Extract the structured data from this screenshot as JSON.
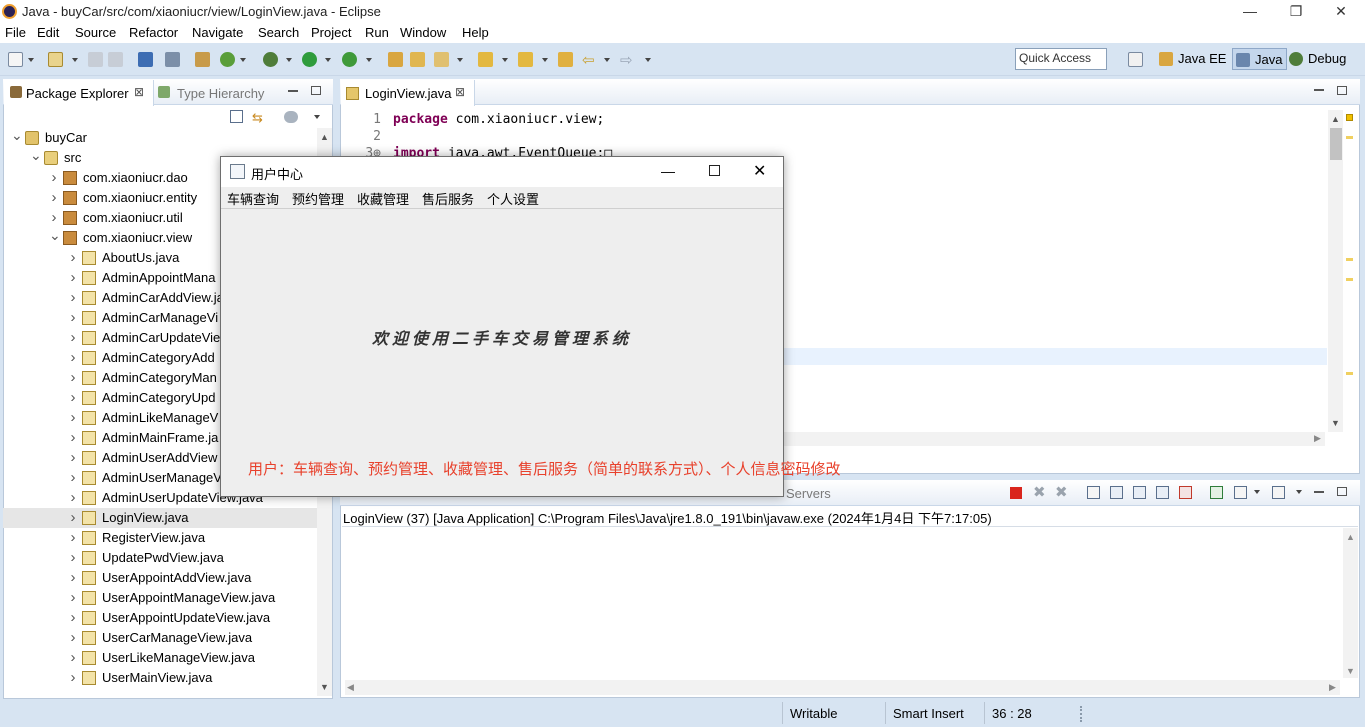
{
  "window": {
    "title": "Java - buyCar/src/com/xiaoniucr/view/LoginView.java - Eclipse",
    "minimize": "—",
    "maximize": "❐",
    "close": "✕"
  },
  "menubar": {
    "items": [
      "File",
      "Edit",
      "Source",
      "Refactor",
      "Navigate",
      "Search",
      "Project",
      "Run",
      "Window",
      "Help"
    ]
  },
  "toolbar": {
    "quick_access_placeholder": "Quick Access",
    "perspectives": [
      "Java EE",
      "Java",
      "Debug"
    ]
  },
  "left_panel": {
    "tabs": [
      "Package Explorer",
      "Type Hierarchy"
    ],
    "tree": [
      {
        "label": "buyCar",
        "icon": "project-icon",
        "expanded": true
      },
      {
        "label": "src",
        "icon": "source-folder-icon",
        "expanded": true
      },
      {
        "label": "com.xiaoniucr.dao",
        "icon": "package-icon",
        "expanded": false
      },
      {
        "label": "com.xiaoniucr.entity",
        "icon": "package-icon",
        "expanded": false
      },
      {
        "label": "com.xiaoniucr.util",
        "icon": "package-icon",
        "expanded": false
      },
      {
        "label": "com.xiaoniucr.view",
        "icon": "package-icon",
        "expanded": true
      },
      {
        "label": "AboutUs.java",
        "icon": "java-file-icon"
      },
      {
        "label": "AdminAppointMana",
        "icon": "java-file-icon"
      },
      {
        "label": "AdminCarAddView.ja",
        "icon": "java-file-icon"
      },
      {
        "label": "AdminCarManageVi",
        "icon": "java-file-icon"
      },
      {
        "label": "AdminCarUpdateVie",
        "icon": "java-file-icon"
      },
      {
        "label": "AdminCategoryAdd",
        "icon": "java-file-icon"
      },
      {
        "label": "AdminCategoryMan",
        "icon": "java-file-icon"
      },
      {
        "label": "AdminCategoryUpd",
        "icon": "java-file-icon"
      },
      {
        "label": "AdminLikeManageV",
        "icon": "java-file-icon"
      },
      {
        "label": "AdminMainFrame.ja",
        "icon": "java-file-icon"
      },
      {
        "label": "AdminUserAddView",
        "icon": "java-file-icon"
      },
      {
        "label": "AdminUserManageV",
        "icon": "java-file-icon"
      },
      {
        "label": "AdminUserUpdateView.java",
        "icon": "java-file-icon"
      },
      {
        "label": "LoginView.java",
        "icon": "java-file-icon",
        "selected": true
      },
      {
        "label": "RegisterView.java",
        "icon": "java-file-icon"
      },
      {
        "label": "UpdatePwdView.java",
        "icon": "java-file-icon"
      },
      {
        "label": "UserAppointAddView.java",
        "icon": "java-file-icon"
      },
      {
        "label": "UserAppointManageView.java",
        "icon": "java-file-icon"
      },
      {
        "label": "UserAppointUpdateView.java",
        "icon": "java-file-icon"
      },
      {
        "label": "UserCarManageView.java",
        "icon": "java-file-icon"
      },
      {
        "label": "UserLikeManageView.java",
        "icon": "java-file-icon"
      },
      {
        "label": "UserMainView.java",
        "icon": "java-file-icon"
      }
    ]
  },
  "editor": {
    "tab": "LoginView.java",
    "lines": [
      {
        "num": "1",
        "keyword": "package",
        "text": " com.xiaoniucr.view;"
      },
      {
        "num": "2",
        "keyword": "",
        "text": ""
      },
      {
        "num": "3⊕",
        "keyword": "import",
        "text": " java.awt.EventQueue;□"
      }
    ]
  },
  "console": {
    "tab_visible": "Servers",
    "line": "LoginView (37) [Java Application] C:\\Program Files\\Java\\jre1.8.0_191\\bin\\javaw.exe (2024年1月4日 下午7:17:05)"
  },
  "statusbar": {
    "writable": "Writable",
    "insert_mode": "Smart Insert",
    "position": "36 : 28"
  },
  "swing_window": {
    "title": "用户中心",
    "menu": [
      "车辆查询",
      "预约管理",
      "收藏管理",
      "售后服务",
      "个人设置"
    ],
    "welcome": "欢迎使用二手车交易管理系统"
  },
  "annotation": "用户：车辆查询、预约管理、收藏管理、售后服务（简单的联系方式）、个人信息密码修改",
  "colors": {
    "chrome_bg": "#d7e4f2",
    "annotation": "#e8412c",
    "keyword": "#7f0055"
  }
}
